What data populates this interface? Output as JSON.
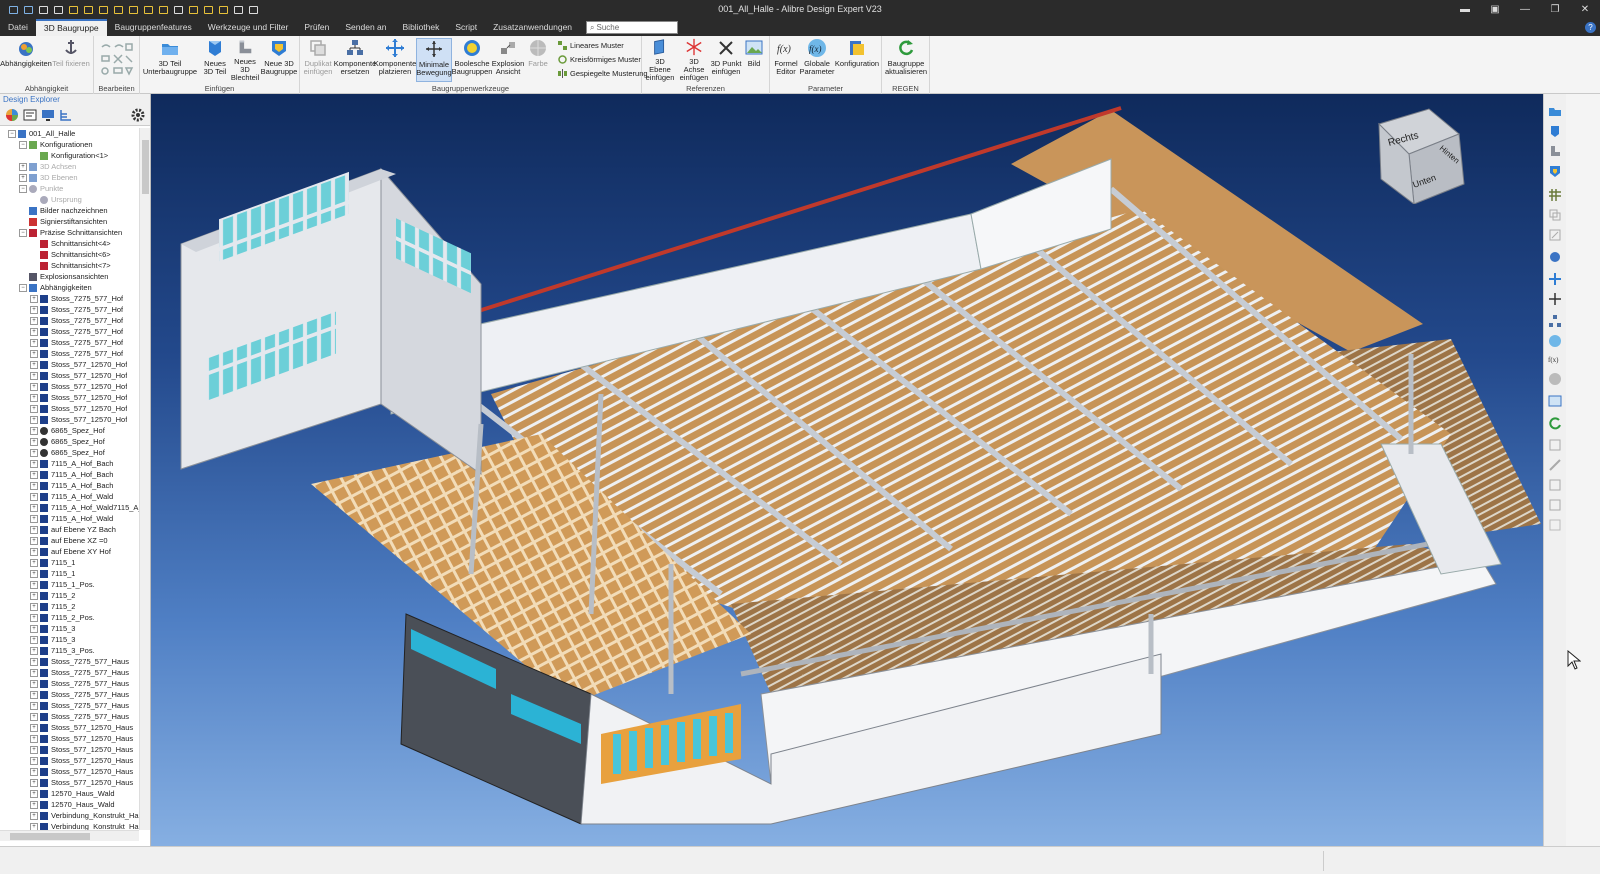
{
  "window": {
    "title": "001_All_Halle - Alibre Design Expert V23",
    "min_label": "—",
    "restore_label": "❐",
    "close_label": "✕"
  },
  "menu_tabs": [
    "Datei",
    "3D Baugruppe",
    "Baugruppenfeatures",
    "Werkzeuge und Filter",
    "Prüfen",
    "Senden an",
    "Bibliothek",
    "Script",
    "Zusatzanwendungen"
  ],
  "active_tab": "3D Baugruppe",
  "search": {
    "placeholder": "Suche"
  },
  "help_label": "?",
  "ribbon": {
    "groups": [
      {
        "label": "Abhängigkeit"
      },
      {
        "label": "Bearbeiten"
      },
      {
        "label": "Einfügen"
      },
      {
        "label": "Baugruppenwerkzeuge"
      },
      {
        "label": "Referenzen"
      },
      {
        "label": "Parameter"
      },
      {
        "label": "REGEN"
      }
    ],
    "buttons": {
      "abhaengigkeiten": "Abhängigkeiten",
      "teil_fixieren": "Teil fixieren",
      "unterbaugruppe": "3D Teil Unterbaugruppe",
      "neues_teil": "Neues 3D Teil",
      "neues_blechteil": "Neues 3D Blechteil",
      "neue_baugruppe": "Neue 3D Baugruppe",
      "duplikat": "Duplikat einfügen",
      "komponente_ersetzen": "Komponente ersetzen",
      "komponente_platzieren": "Komponente platzieren",
      "minimale_bewegung": "Minimale Bewegung",
      "boolesche": "Boolesche Baugruppen",
      "explosion": "Explosion Ansicht",
      "farbe": "Farbe",
      "lineares_muster": "Lineares Muster",
      "kreisfoermiges_muster": "Kreisförmiges Muster",
      "gespiegelte_musterung": "Gespiegelte Musterung",
      "ebene": "3D Ebene einfügen",
      "achse": "3D Achse einfügen",
      "punkt": "3D Punkt einfügen",
      "bild": "Bild",
      "formel_editor": "Formel Editor",
      "globale_parameter": "Globale Parameter",
      "konfiguration": "Konfiguration",
      "baugruppe_aktualisieren": "Baugruppe aktualisieren"
    }
  },
  "explorer": {
    "title": "Design Explorer",
    "tree": [
      {
        "label": "001_All_Halle",
        "level": 0,
        "exp": "−",
        "icon": "assembly"
      },
      {
        "label": "Konfigurationen",
        "level": 1,
        "exp": "−",
        "icon": "config"
      },
      {
        "label": "Konfiguration<1>",
        "level": 2,
        "exp": "",
        "icon": "config"
      },
      {
        "label": "3D Achsen",
        "level": 1,
        "exp": "+",
        "icon": "axis",
        "dim": true
      },
      {
        "label": "3D Ebenen",
        "level": 1,
        "exp": "+",
        "icon": "plane",
        "dim": true
      },
      {
        "label": "Punkte",
        "level": 1,
        "exp": "−",
        "icon": "point",
        "dim": true
      },
      {
        "label": "Ursprung",
        "level": 2,
        "exp": "",
        "icon": "point",
        "dim": true
      },
      {
        "label": "Bilder nachzeichnen",
        "level": 1,
        "exp": "",
        "icon": "image"
      },
      {
        "label": "Signierstiftansichten",
        "level": 1,
        "exp": "",
        "icon": "pen"
      },
      {
        "label": "Präzise Schnittansichten",
        "level": 1,
        "exp": "−",
        "icon": "section"
      },
      {
        "label": "Schnittansicht<4>",
        "level": 2,
        "exp": "",
        "icon": "section"
      },
      {
        "label": "Schnittansicht<6>",
        "level": 2,
        "exp": "",
        "icon": "section"
      },
      {
        "label": "Schnittansicht<7>",
        "level": 2,
        "exp": "",
        "icon": "section"
      },
      {
        "label": "Explosionsansichten",
        "level": 1,
        "exp": "",
        "icon": "explode"
      },
      {
        "label": "Abhängigkeiten",
        "level": 1,
        "exp": "−",
        "icon": "constraint"
      },
      {
        "label": "Stoss_7275_577_Hof",
        "level": 2,
        "exp": "+",
        "icon": "mate"
      },
      {
        "label": "Stoss_7275_577_Hof",
        "level": 2,
        "exp": "+",
        "icon": "mate"
      },
      {
        "label": "Stoss_7275_577_Hof",
        "level": 2,
        "exp": "+",
        "icon": "mate"
      },
      {
        "label": "Stoss_7275_577_Hof",
        "level": 2,
        "exp": "+",
        "icon": "mate"
      },
      {
        "label": "Stoss_7275_577_Hof",
        "level": 2,
        "exp": "+",
        "icon": "mate"
      },
      {
        "label": "Stoss_7275_577_Hof",
        "level": 2,
        "exp": "+",
        "icon": "mate"
      },
      {
        "label": "Stoss_577_12570_Hof",
        "level": 2,
        "exp": "+",
        "icon": "mate"
      },
      {
        "label": "Stoss_577_12570_Hof",
        "level": 2,
        "exp": "+",
        "icon": "mate"
      },
      {
        "label": "Stoss_577_12570_Hof",
        "level": 2,
        "exp": "+",
        "icon": "mate"
      },
      {
        "label": "Stoss_577_12570_Hof",
        "level": 2,
        "exp": "+",
        "icon": "mate"
      },
      {
        "label": "Stoss_577_12570_Hof",
        "level": 2,
        "exp": "+",
        "icon": "mate"
      },
      {
        "label": "Stoss_577_12570_Hof",
        "level": 2,
        "exp": "+",
        "icon": "mate"
      },
      {
        "label": "6865_Spez_Hof",
        "level": 2,
        "exp": "+",
        "icon": "gear"
      },
      {
        "label": "6865_Spez_Hof",
        "level": 2,
        "exp": "+",
        "icon": "gear"
      },
      {
        "label": "6865_Spez_Hof",
        "level": 2,
        "exp": "+",
        "icon": "gear"
      },
      {
        "label": "7115_A_Hof_Bach",
        "level": 2,
        "exp": "+",
        "icon": "mate"
      },
      {
        "label": "7115_A_Hof_Bach",
        "level": 2,
        "exp": "+",
        "icon": "mate"
      },
      {
        "label": "7115_A_Hof_Bach",
        "level": 2,
        "exp": "+",
        "icon": "mate"
      },
      {
        "label": "7115_A_Hof_Wald",
        "level": 2,
        "exp": "+",
        "icon": "mate"
      },
      {
        "label": "7115_A_Hof_Wald7115_A_H",
        "level": 2,
        "exp": "+",
        "icon": "mate"
      },
      {
        "label": "7115_A_Hof_Wald",
        "level": 2,
        "exp": "+",
        "icon": "mate"
      },
      {
        "label": "auf Ebene YZ Bach",
        "level": 2,
        "exp": "+",
        "icon": "mate"
      },
      {
        "label": "auf Ebene XZ =0",
        "level": 2,
        "exp": "+",
        "icon": "mate"
      },
      {
        "label": "auf Ebene XY Hof",
        "level": 2,
        "exp": "+",
        "icon": "mate"
      },
      {
        "label": "7115_1",
        "level": 2,
        "exp": "+",
        "icon": "mate"
      },
      {
        "label": "7115_1",
        "level": 2,
        "exp": "+",
        "icon": "mate"
      },
      {
        "label": "7115_1_Pos.",
        "level": 2,
        "exp": "+",
        "icon": "mate"
      },
      {
        "label": "7115_2",
        "level": 2,
        "exp": "+",
        "icon": "mate"
      },
      {
        "label": "7115_2",
        "level": 2,
        "exp": "+",
        "icon": "mate"
      },
      {
        "label": "7115_2_Pos.",
        "level": 2,
        "exp": "+",
        "icon": "mate"
      },
      {
        "label": "7115_3",
        "level": 2,
        "exp": "+",
        "icon": "mate"
      },
      {
        "label": "7115_3",
        "level": 2,
        "exp": "+",
        "icon": "mate"
      },
      {
        "label": "7115_3_Pos.",
        "level": 2,
        "exp": "+",
        "icon": "mate"
      },
      {
        "label": "Stoss_7275_577_Haus",
        "level": 2,
        "exp": "+",
        "icon": "mate"
      },
      {
        "label": "Stoss_7275_577_Haus",
        "level": 2,
        "exp": "+",
        "icon": "mate"
      },
      {
        "label": "Stoss_7275_577_Haus",
        "level": 2,
        "exp": "+",
        "icon": "mate"
      },
      {
        "label": "Stoss_7275_577_Haus",
        "level": 2,
        "exp": "+",
        "icon": "mate"
      },
      {
        "label": "Stoss_7275_577_Haus",
        "level": 2,
        "exp": "+",
        "icon": "mate"
      },
      {
        "label": "Stoss_7275_577_Haus",
        "level": 2,
        "exp": "+",
        "icon": "mate"
      },
      {
        "label": "Stoss_577_12570_Haus",
        "level": 2,
        "exp": "+",
        "icon": "mate"
      },
      {
        "label": "Stoss_577_12570_Haus",
        "level": 2,
        "exp": "+",
        "icon": "mate"
      },
      {
        "label": "Stoss_577_12570_Haus",
        "level": 2,
        "exp": "+",
        "icon": "mate"
      },
      {
        "label": "Stoss_577_12570_Haus",
        "level": 2,
        "exp": "+",
        "icon": "mate"
      },
      {
        "label": "Stoss_577_12570_Haus",
        "level": 2,
        "exp": "+",
        "icon": "mate"
      },
      {
        "label": "Stoss_577_12570_Haus",
        "level": 2,
        "exp": "+",
        "icon": "mate"
      },
      {
        "label": "12570_Haus_Wald",
        "level": 2,
        "exp": "+",
        "icon": "mate"
      },
      {
        "label": "12570_Haus_Wald",
        "level": 2,
        "exp": "+",
        "icon": "mate"
      },
      {
        "label": "Verbindung_Konstrukt_Hau",
        "level": 2,
        "exp": "+",
        "icon": "mate"
      },
      {
        "label": "Verbindung_Konstrukt_Hau",
        "level": 2,
        "exp": "+",
        "icon": "mate"
      }
    ]
  },
  "viewcube": {
    "front": "Unten",
    "top": "Rechts",
    "right": "Hinten"
  },
  "colors": {
    "accent": "#3a73c4",
    "viewport_top": "#0f2a5c",
    "viewport_bottom": "#86afe2",
    "wood": "#c9955a",
    "roof_edge": "#c0392b"
  }
}
